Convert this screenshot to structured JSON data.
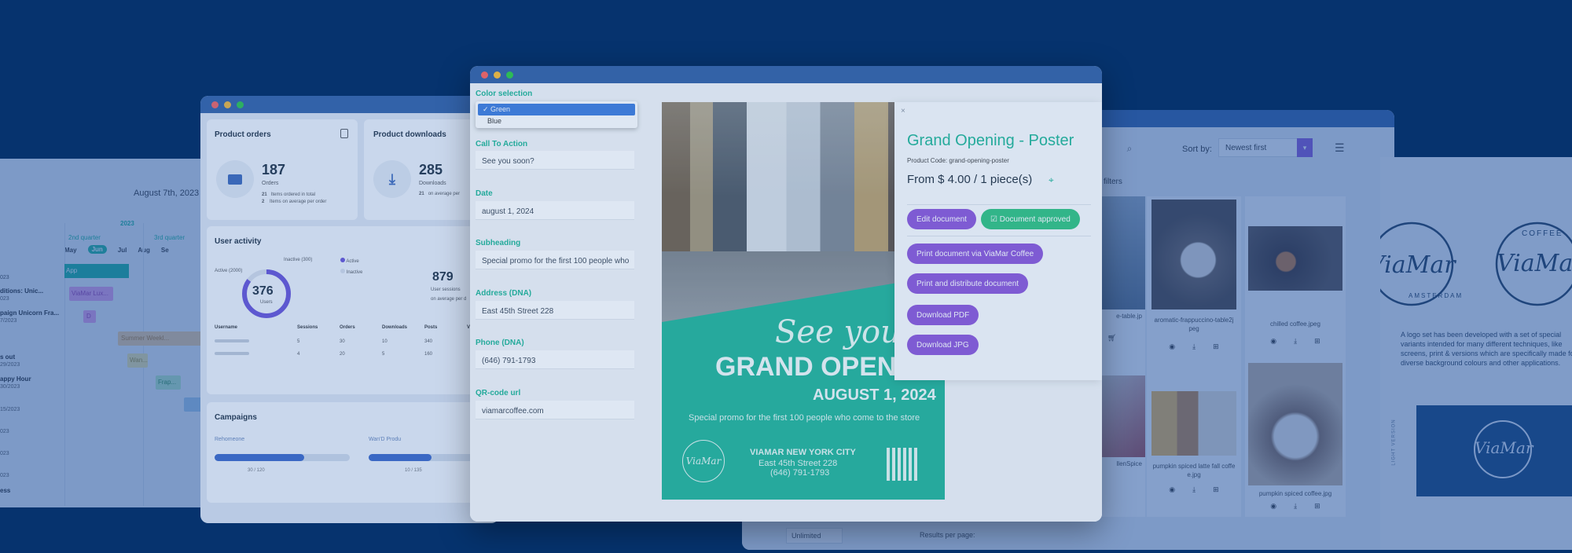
{
  "calendar": {
    "date": "August 7th, 2023",
    "year": "2023",
    "quarters": [
      "2nd quarter",
      "3rd quarter"
    ],
    "months": [
      "May",
      "Jun",
      "Jul",
      "Aug",
      "Se"
    ],
    "rows": [
      {
        "title": "023",
        "bar": "App"
      },
      {
        "title": "ditions: Unic...",
        "date": "023",
        "bar": "ViaMar Lux..."
      },
      {
        "title": "paign Unicorn Fra...",
        "date": "7/2023",
        "bar": "D"
      },
      {
        "title": "",
        "date": "",
        "bar": "Summer Weekl..."
      },
      {
        "title": "s out",
        "date": "29/2023",
        "bar": "Wan..."
      },
      {
        "title": "appy Hour",
        "date": "30/2023",
        "bar": "Frap..."
      },
      {
        "title": "",
        "date": "15/2023",
        "bar": ""
      }
    ],
    "extra_rows": [
      "023",
      "023",
      "023",
      "ess"
    ]
  },
  "dashboard": {
    "orders_title": "Product orders",
    "orders_value": "187",
    "orders_label": "Orders",
    "orders_lines": [
      "Items ordered in total",
      "Items on average per order"
    ],
    "orders_nums": [
      "21",
      "2"
    ],
    "downloads_title": "Product downloads",
    "downloads_value": "285",
    "downloads_label": "Downloads",
    "downloads_num": "21",
    "downloads_line": "on average per",
    "activity_title": "User activity",
    "donut_value": "376",
    "donut_label": "Users",
    "active_label": "Active (2000)",
    "inactive_label": "Inactive (300)",
    "legend_active": "Active",
    "legend_inactive": "Inactive",
    "sessions_value": "879",
    "sessions_label": "User sessions",
    "sessions_sub": "on average per d",
    "table_headers": [
      "Username",
      "Sessions",
      "Orders",
      "Downloads",
      "Posts",
      "V"
    ],
    "table_rows": [
      [
        "",
        "5",
        "30",
        "10",
        "340",
        ""
      ],
      [
        "",
        "4",
        "20",
        "5",
        "160",
        ""
      ]
    ],
    "campaigns_title": "Campaigns",
    "campaign_names": [
      "Rehomeone",
      "Wan'D Produ"
    ],
    "campaign_sub1": "30 / 120",
    "campaign_sub2": "10 / 135"
  },
  "gallery": {
    "sort_label": "Sort by:",
    "sort_value": "Newest first",
    "filters": "filters",
    "items": [
      {
        "caption": "e-table.jp"
      },
      {
        "caption": "aromatic-frappuccino-table2j peg"
      },
      {
        "caption": "chilled coffee.jpeg"
      },
      {
        "caption": "llenSpice"
      },
      {
        "caption": "pumpkin spiced latte fall coffe e.jpg"
      },
      {
        "caption": "pumpkin spiced coffee.jpg"
      }
    ],
    "footer_left": "Unlimited",
    "footer_results": "Results per page:"
  },
  "logo_panel": {
    "brand": "ViaMar",
    "coffee": "COFFEE",
    "city": "AMSTERDAM",
    "description": "A logo set has been developed with a set of special variants intended for many different techniques, like screens, print & versions which are specifically made fo diverse background colours and other applications.",
    "side_label": "LIGHT VERSION"
  },
  "editor": {
    "color_label": "Color selection",
    "color_options": [
      "Green",
      "Blue"
    ],
    "color_selected": "Green",
    "fields": [
      {
        "label": "Call To Action",
        "value": "See you soon?"
      },
      {
        "label": "Date",
        "value": "august 1, 2024"
      },
      {
        "label": "Subheading",
        "value": "Special promo for the first 100 people who"
      },
      {
        "label": "Address (DNA)",
        "value": "East 45th Street 228"
      },
      {
        "label": "Phone (DNA)",
        "value": "(646) 791-1793"
      },
      {
        "label": "QR-code url",
        "value": "viamarcoffee.com"
      }
    ],
    "poster": {
      "script": "See you soon",
      "headline": "GRAND OPENING",
      "date": "AUGUST 1, 2024",
      "subheading": "Special promo for the first 100 people who come to the store",
      "city": "VIAMAR NEW YORK CITY",
      "address": "East 45th Street 228",
      "phone": "(646) 791-1793",
      "logo_text": "ViaMar",
      "accent": "#1fb497"
    },
    "panel": {
      "title": "Grand Opening - Poster",
      "product_code": "Product Code: grand-opening-poster",
      "price": "From $ 4.00 / 1 piece(s)",
      "edit": "Edit document",
      "approved": "Document approved",
      "print_via": "Print document via ViaMar Coffee",
      "print_distribute": "Print and distribute document",
      "download_pdf": "Download PDF",
      "download_jpg": "Download JPG"
    }
  },
  "colors": {
    "background": "#06336e",
    "accent_green": "#1db594",
    "accent_purple": "#8a55d8",
    "approved_green": "#2ec27e"
  }
}
